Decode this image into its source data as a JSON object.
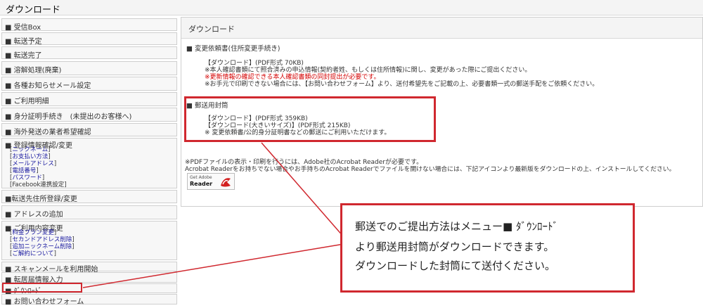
{
  "header": {
    "title": "ダウンロード"
  },
  "sidebar": {
    "items": [
      {
        "label": "■ 受信Box"
      },
      {
        "label": "■ 転送予定"
      },
      {
        "label": "■ 転送完了"
      },
      {
        "label": "■ 溶解処理(廃棄)"
      },
      {
        "label": "■ 各種お知らせメール設定"
      },
      {
        "label": "■ ご利用明細"
      },
      {
        "label": "■ 身分証明手続き　(未提出のお客様へ)"
      },
      {
        "label": "■ 海外発送の業者希望確認"
      },
      {
        "label": "■ 登録情報確認/変更"
      },
      {
        "label": "■転送先住所登録/変更"
      },
      {
        "label": "■ アドレスの追加"
      },
      {
        "label": "■ ご利用内容変更"
      },
      {
        "label": "■ スキャンメールを利用開始"
      },
      {
        "label": "■ 転居届情報入力"
      },
      {
        "label": "■ ﾀﾞｳﾝﾛｰﾄﾞ"
      },
      {
        "label": "■ お問い合わせフォーム"
      }
    ],
    "registration_sub": [
      "ニックネーム",
      "お支払い方法",
      "メールアドレス",
      "電話番号",
      "パスワード",
      "Facebook連携設定"
    ],
    "usage_sub": [
      "料金プラン変更",
      "セカンドアドレス削除",
      "追加ニックネーム削除",
      "ご解約について"
    ]
  },
  "main": {
    "title": "ダウンロード",
    "section1": {
      "heading": "■ 変更依頼書(住所変更手続き)",
      "link": "【ダウンロード】(PDF形式 70KB)",
      "note1": "※本人確認書類にて照合済みの申込情報(契約者姓、もしくは住所情報)に関し、変更があった際にご提出ください。",
      "note_red": "※更新情報の確認できる本人確認書類の同封提出が必要です。",
      "note2": "※お手元で印刷できない場合には、【お問い合わせフォーム】より、送付希望先をご記載の上、必要書類一式の郵送手配をご依頼ください。"
    },
    "section2": {
      "heading": "■ 郵送用封筒",
      "link1": "【ダウンロード】(PDF形式 359KB)",
      "link2": "【ダウンロード(大きいサイズ)】(PDF形式 215KB)",
      "note": "※ 変更依頼書/公的身分証明書などの郵送にご利用いただけます。"
    },
    "pdf_note1": "※PDFファイルの表示・印刷を行うには、Adobe社のAcrobat Readerが必要です。",
    "pdf_note2": "Acrobat Readerをお持ちでない場合やお手持ちのAcrobat Readerでファイルを開けない場合には、下記アイコンより最新版をダウンロードの上、インストールしてください。",
    "adobe_line1": "Get Adobe",
    "adobe_line2": "Reader"
  },
  "callout": {
    "line1": "郵送でのご提出方法はメニュー■ ﾀﾞｳﾝﾛｰﾄﾞ",
    "line2": "より郵送用封筒がダウンロードできます。",
    "line3": "ダウンロードした封筒にて送付ください。"
  },
  "colors": {
    "highlight": "#d0282f",
    "warning_text": "#d40000",
    "link_text": "#1a1aa0"
  }
}
